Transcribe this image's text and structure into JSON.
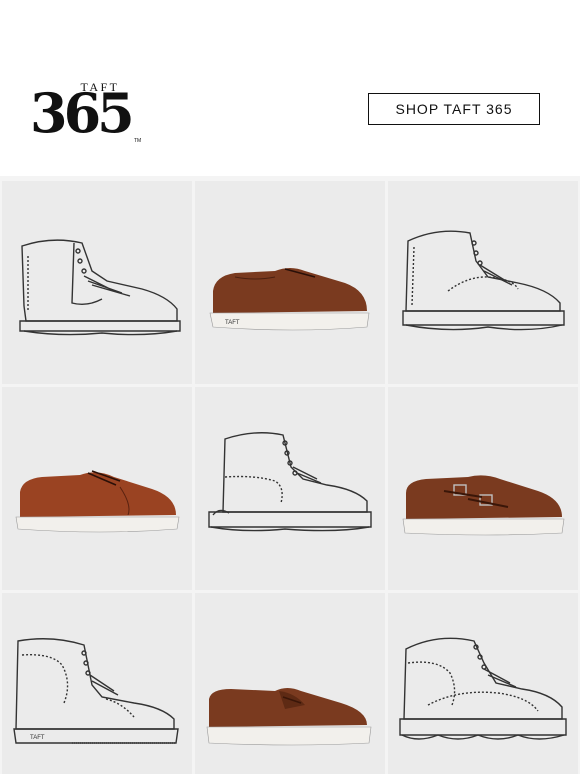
{
  "brand": {
    "logo_small": "TAFT",
    "logo_big": "365",
    "logo_tm": "TM"
  },
  "header": {
    "shop_button_label": "SHOP TAFT 365"
  },
  "products": [
    {
      "name": "white-high-top-boot-sketch",
      "style": "outline",
      "sole_label": ""
    },
    {
      "name": "brown-oxford",
      "style": "brown",
      "sole_label": "TAFT"
    },
    {
      "name": "moc-toe-boot-sketch",
      "style": "outline",
      "sole_label": ""
    },
    {
      "name": "cognac-cap-toe-oxford",
      "style": "cognac",
      "sole_label": ""
    },
    {
      "name": "lace-up-boot-sketch",
      "style": "outline",
      "sole_label": ""
    },
    {
      "name": "brown-double-monk-strap",
      "style": "brown",
      "sole_label": ""
    },
    {
      "name": "wingtip-brogue-boot-sketch",
      "style": "outline",
      "sole_label": "TAFT"
    },
    {
      "name": "brown-penny-loafer",
      "style": "brown",
      "sole_label": ""
    },
    {
      "name": "wingtip-hiking-boot-sketch",
      "style": "outline",
      "sole_label": ""
    }
  ],
  "colors": {
    "brown_leather": "#7a3a1f",
    "cognac_leather": "#9a4322",
    "tile_background": "#ebebeb",
    "outline_stroke": "#333333",
    "sole_white": "#f2f0ec"
  }
}
